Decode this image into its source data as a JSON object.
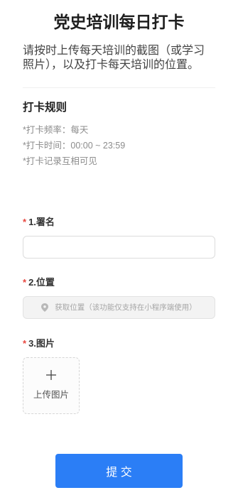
{
  "page": {
    "title": "党史培训每日打卡",
    "description": "请按时上传每天培训的截图（或学习照片），以及打卡每天培训的位置。"
  },
  "rules": {
    "heading": "打卡规则",
    "items": [
      "*打卡频率：每天",
      "*打卡时间：00:00 ~ 23:59",
      "*打卡记录互相可见"
    ]
  },
  "form": {
    "name_field": {
      "required_mark": "*",
      "label": "1.署名",
      "value": ""
    },
    "location_field": {
      "required_mark": "*",
      "label": "2.位置",
      "icon": "location-pin-icon",
      "button_text": "获取位置（该功能仅支持在小程序端使用）"
    },
    "image_field": {
      "required_mark": "*",
      "label": "3.图片",
      "icon": "plus-icon",
      "upload_text": "上传图片"
    },
    "submit_label": "提 交"
  },
  "colors": {
    "accent": "#2b7ef6",
    "required": "#e8473f",
    "title": "#1f1f1f",
    "muted": "#8c8c8c"
  }
}
